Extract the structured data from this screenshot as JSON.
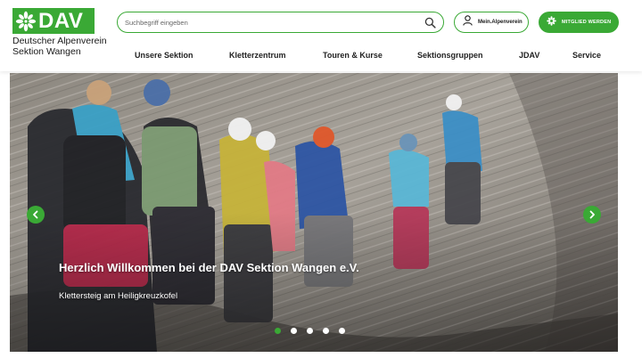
{
  "brand": {
    "logo_text": "DAV",
    "name_line1": "Deutscher Alpenverein",
    "name_line2": "Sektion Wangen",
    "accent_color": "#3aa935"
  },
  "search": {
    "placeholder": "Suchbegriff eingeben",
    "value": "",
    "icon": "search-icon"
  },
  "account": {
    "login_label": "Mein.Alpenverein",
    "login_icon": "user-icon",
    "member_label": "MITGLIED WERDEN",
    "member_icon": "edelweiss-icon"
  },
  "nav": {
    "items": [
      {
        "label": "Unsere Sektion"
      },
      {
        "label": "Kletterzentrum"
      },
      {
        "label": "Touren & Kurse"
      },
      {
        "label": "Sektionsgruppen"
      },
      {
        "label": "JDAV"
      },
      {
        "label": "Service"
      }
    ]
  },
  "hero": {
    "title": "Herzlich Willkommen bei der DAV Sektion Wangen e.V.",
    "caption": "Klettersteig am Heiligkreuzkofel",
    "prev_icon": "chevron-left-icon",
    "next_icon": "chevron-right-icon",
    "slide_count": 5,
    "active_slide": 1
  }
}
